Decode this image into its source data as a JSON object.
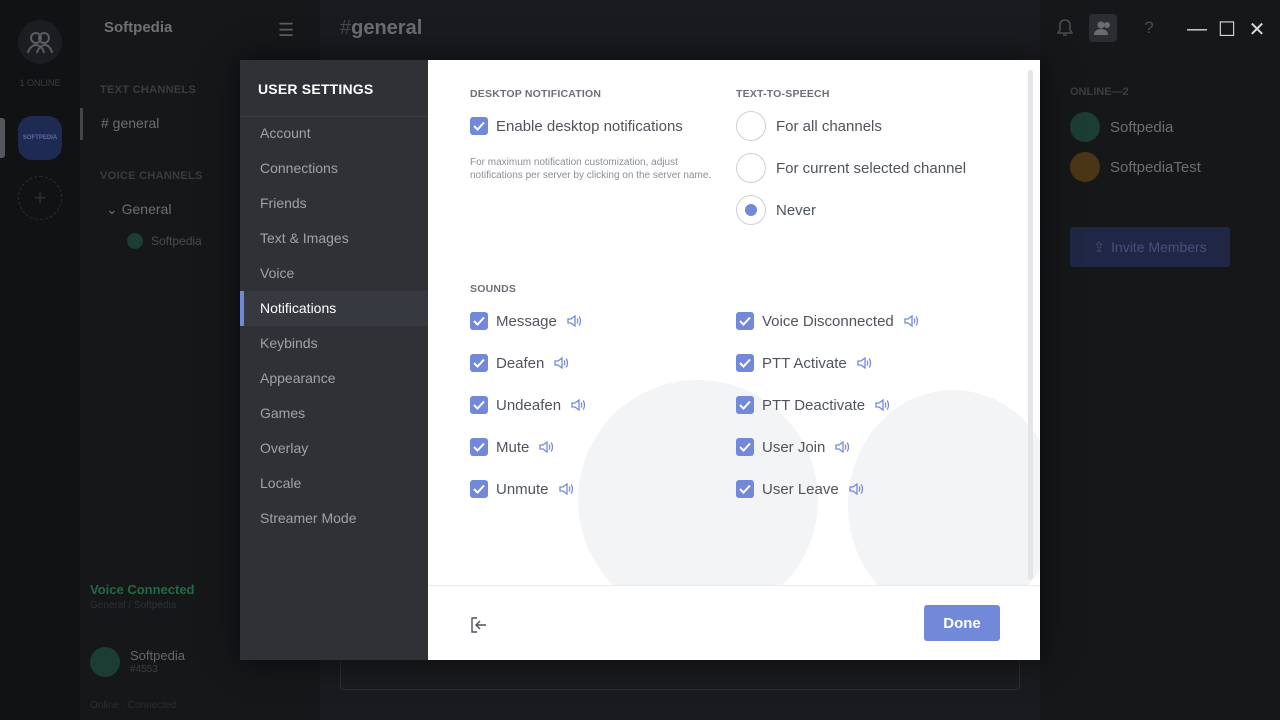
{
  "app": {
    "online_label": "1 ONLINE",
    "server_badge": "SOFTPEDIA",
    "server_name": "Softpedia",
    "text_channels_label": "TEXT CHANNELS",
    "text_channel": "# general",
    "voice_channels_label": "VOICE CHANNELS",
    "voice_channel": "General",
    "voice_user": "Softpedia",
    "voice_connected": "Voice Connected",
    "voice_connected_sub": "General / Softpedia",
    "user_name": "Softpedia",
    "user_tag": "#4553",
    "footer_text": "Online · Connected",
    "chat_hash": "#",
    "chat_title": "general",
    "members_header": "ONLINE—2",
    "members": [
      "Softpedia",
      "SoftpediaTest"
    ],
    "invite_label": "Invite Members"
  },
  "window": {
    "minimize": "—",
    "maximize": "☐",
    "close": "✕"
  },
  "settings": {
    "title": "USER SETTINGS",
    "nav": [
      {
        "label": "Account"
      },
      {
        "label": "Connections"
      },
      {
        "label": "Friends"
      },
      {
        "label": "Text & Images"
      },
      {
        "label": "Voice"
      },
      {
        "label": "Notifications",
        "active": true
      },
      {
        "label": "Keybinds"
      },
      {
        "label": "Appearance"
      },
      {
        "label": "Games"
      },
      {
        "label": "Overlay"
      },
      {
        "label": "Locale"
      },
      {
        "label": "Streamer Mode"
      }
    ],
    "desktop_notification": {
      "header": "DESKTOP NOTIFICATION",
      "enable_label": "Enable desktop notifications",
      "enabled": true,
      "hint": "For maximum notification customization, adjust notifications per server by clicking on the server name."
    },
    "tts": {
      "header": "TEXT-TO-SPEECH",
      "options": [
        "For all channels",
        "For current selected channel",
        "Never"
      ],
      "selected": "Never"
    },
    "sounds": {
      "header": "SOUNDS",
      "left": [
        {
          "label": "Message",
          "checked": true
        },
        {
          "label": "Deafen",
          "checked": true
        },
        {
          "label": "Undeafen",
          "checked": true
        },
        {
          "label": "Mute",
          "checked": true
        },
        {
          "label": "Unmute",
          "checked": true
        }
      ],
      "right": [
        {
          "label": "Voice Disconnected",
          "checked": true
        },
        {
          "label": "PTT Activate",
          "checked": true
        },
        {
          "label": "PTT Deactivate",
          "checked": true
        },
        {
          "label": "User Join",
          "checked": true
        },
        {
          "label": "User Leave",
          "checked": true
        }
      ]
    },
    "done_label": "Done",
    "accent_color": "#7289da"
  }
}
